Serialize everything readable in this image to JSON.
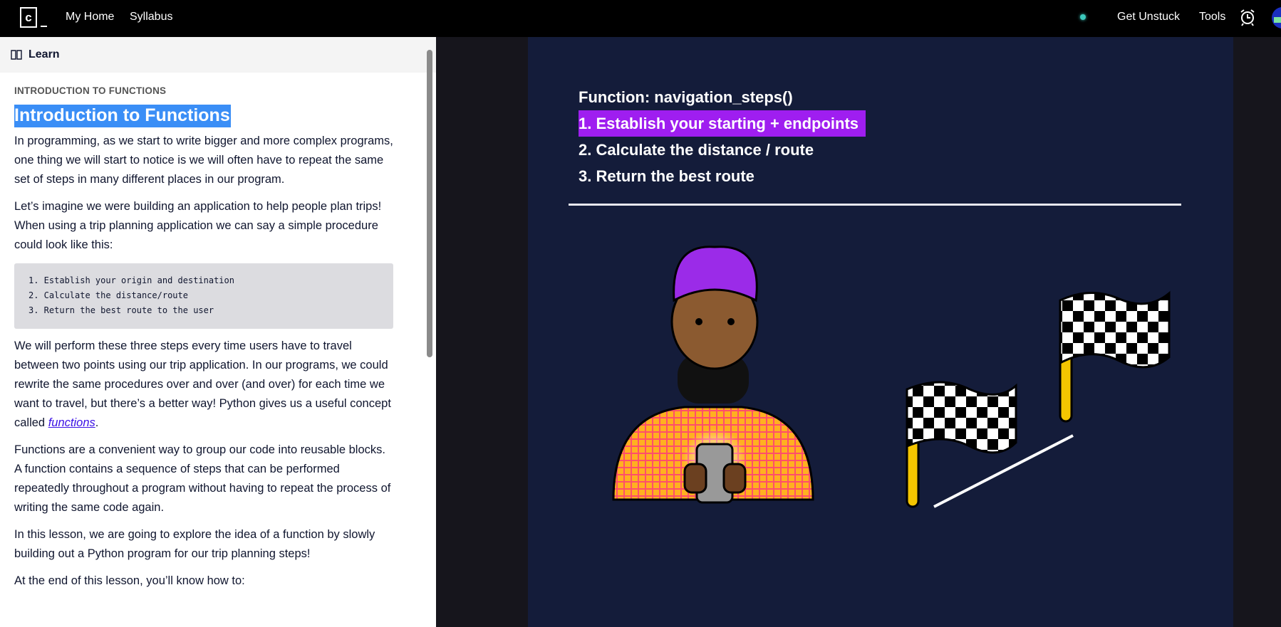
{
  "topbar": {
    "logo_letter": "c",
    "nav": [
      "My Home",
      "Syllabus"
    ],
    "get_unstuck": "Get Unstuck",
    "tools": "Tools",
    "status_color": "#3cc9bd"
  },
  "panel": {
    "tab_label": "Learn",
    "tab_icon": "book-icon"
  },
  "lesson": {
    "eyebrow": "INTRODUCTION TO FUNCTIONS",
    "title": "Introduction to Functions",
    "p1": "In programming, as we start to write bigger and more complex programs, one thing we will start to notice is we will often have to repeat the same set of steps in many different places in our program.",
    "p2": "Let’s imagine we were building an application to help people plan trips! When using a trip planning application we can say a simple procedure could look like this:",
    "code": [
      "1. Establish your origin and destination",
      "2. Calculate the distance/route",
      "3. Return the best route to the user"
    ],
    "p3_before": "We will perform these three steps every time users have to travel between two points using our trip application. In our programs, we could rewrite the same procedures over and over (and over) for each time we want to travel, but there’s a better way! Python gives us a useful concept called ",
    "p3_link": "functions",
    "p3_after": ".",
    "p4": "Functions are a convenient way to group our code into reusable blocks. A function contains a sequence of steps that can be performed repeatedly throughout a program without having to repeat the process of writing the same code again.",
    "p5": "In this lesson, we are going to explore the idea of a function by slowly building out a Python program for our trip planning steps!",
    "p6": "At the end of this lesson, you’ll know how to:"
  },
  "illustration": {
    "heading": "Function: navigation_steps()",
    "steps": [
      "1. Establish your starting + endpoints",
      "2. Calculate the distance / route",
      "3. Return the best route"
    ],
    "highlight_color": "#9f1ef0",
    "background_color": "#141c3a"
  }
}
